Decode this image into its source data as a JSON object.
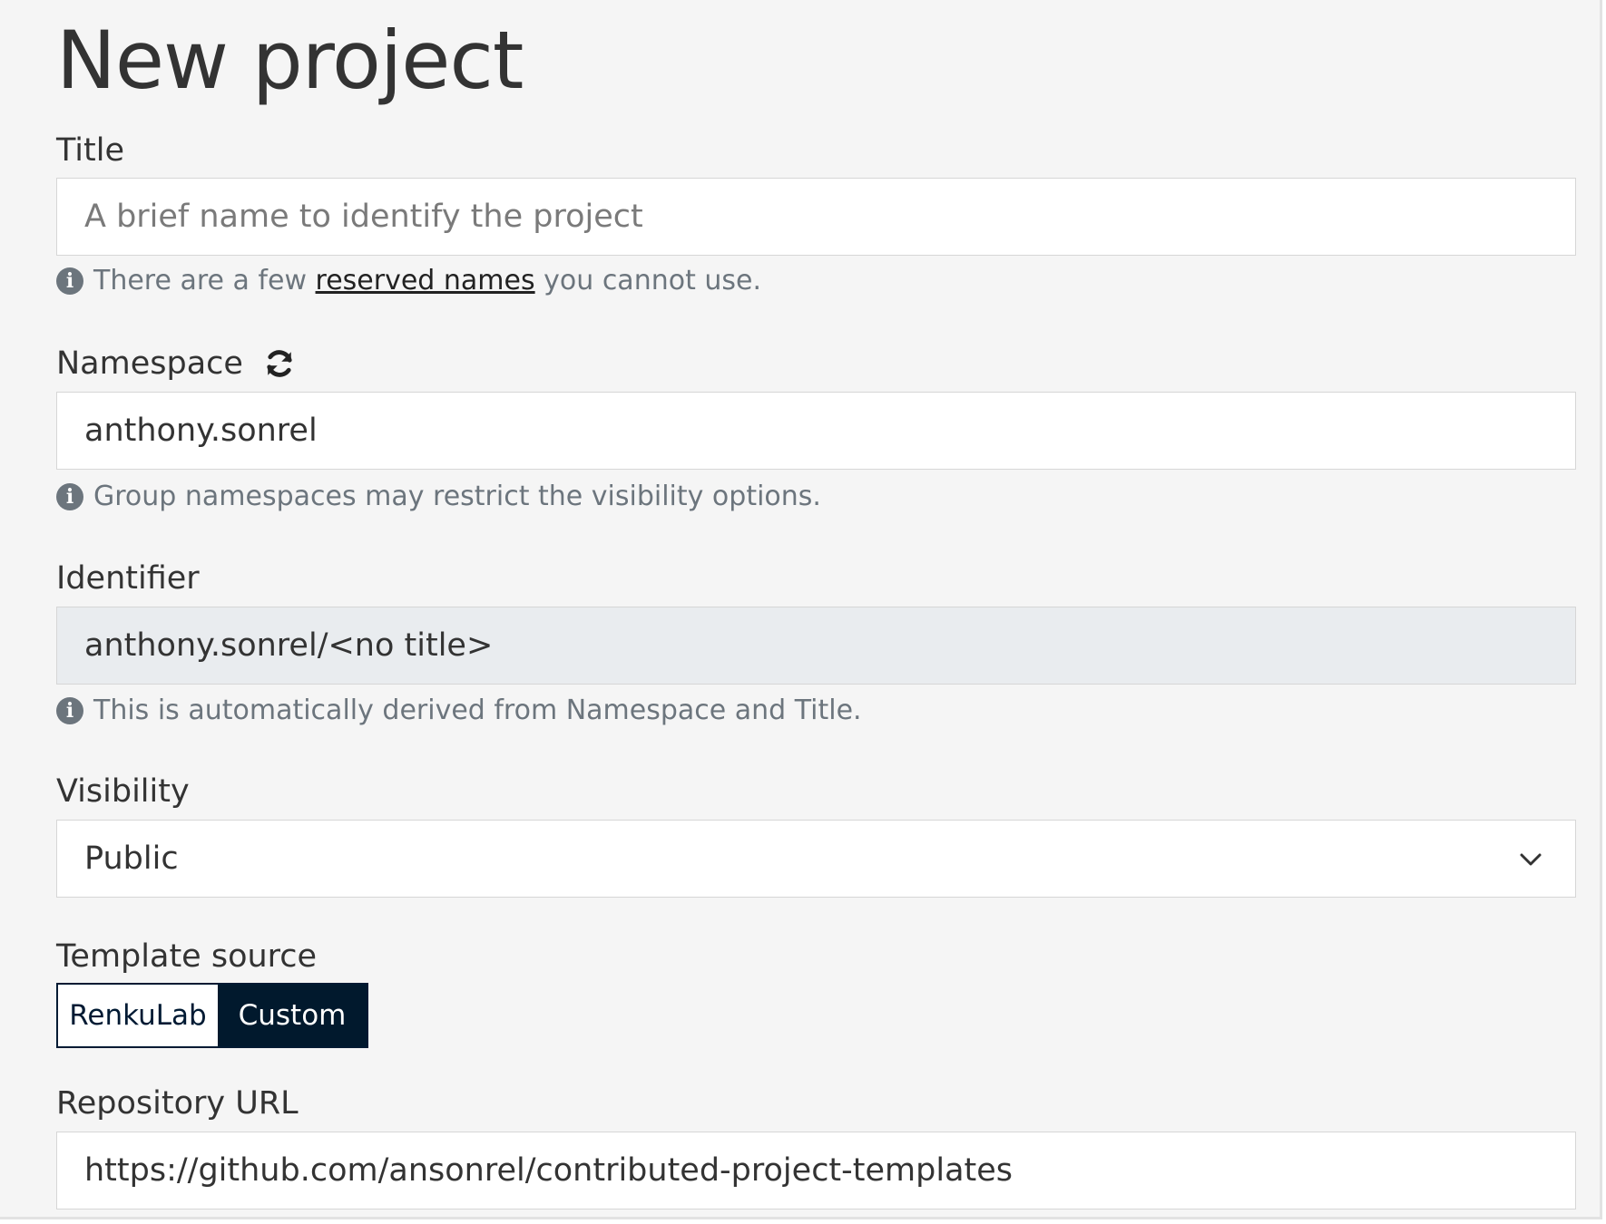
{
  "page": {
    "title": "New project"
  },
  "title_field": {
    "label": "Title",
    "placeholder": "A brief name to identify the project",
    "help_prefix": "There are a few",
    "help_link": "reserved names",
    "help_suffix": "you cannot use."
  },
  "namespace_field": {
    "label": "Namespace",
    "value": "anthony.sonrel",
    "help": "Group namespaces may restrict the visibility options."
  },
  "identifier_field": {
    "label": "Identifier",
    "value": "anthony.sonrel/<no title>",
    "help": "This is automatically derived from Namespace and Title."
  },
  "visibility_field": {
    "label": "Visibility",
    "selected": "Public"
  },
  "template_source": {
    "label": "Template source",
    "options": [
      "RenkuLab",
      "Custom"
    ],
    "active": "Custom"
  },
  "repository_field": {
    "label": "Repository URL",
    "value": "https://github.com/ansonrel/contributed-project-templates"
  },
  "icons": {
    "info": "info-circle-icon",
    "refresh": "sync-icon",
    "dropdown": "chevron-down-icon"
  },
  "colors": {
    "background": "#f5f5f5",
    "text": "#333333",
    "muted": "#6c757d",
    "readonly": "#e9ecef",
    "active_button": "#01192d"
  }
}
